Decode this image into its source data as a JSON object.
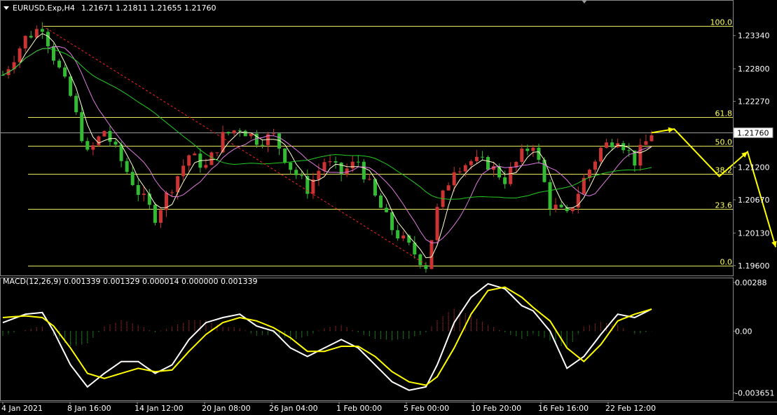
{
  "header": {
    "symbol": "EURUSD.Exp,H4",
    "ohlc": "1.21671 1.21811 1.21655 1.21760",
    "menu_icon": "triangle-down-icon"
  },
  "colors": {
    "bull": "#cc3333",
    "bear": "#33bb33",
    "fib": "#e6e65c",
    "ma_fast": "#ffffcc",
    "ma_mid": "#e07be0",
    "ma_slow": "#22cc22",
    "trend": "#ff2222",
    "arrow": "#ffff00",
    "macd_line": "#ffffff",
    "signal_line": "#ffff00",
    "axis": "#888888"
  },
  "chart_data": [
    {
      "type": "candlestick",
      "title": "EURUSD.Exp,H4",
      "ylim": [
        1.1945,
        1.2385
      ],
      "y_ticks": [
        "1.23340",
        "1.22800",
        "1.22270",
        "1.21760",
        "1.21200",
        "1.20670",
        "1.20130",
        "1.19600"
      ],
      "current_price": "1.21760",
      "fibonacci": {
        "high": 1.235,
        "low": 1.196,
        "levels": [
          {
            "label": "100.0",
            "ratio": 1.0
          },
          {
            "label": "61.8",
            "ratio": 0.618
          },
          {
            "label": "50.0",
            "ratio": 0.5
          },
          {
            "label": "38.2",
            "ratio": 0.382
          },
          {
            "label": "23.6",
            "ratio": 0.236
          },
          {
            "label": "0.0",
            "ratio": 0.0
          }
        ]
      },
      "trend_line": {
        "from": [
          "4 Jan 2021",
          1.235
        ],
        "to": [
          "5 Feb 00:00",
          1.1962
        ]
      },
      "price_path": [
        [
          0,
          1.227
        ],
        [
          4,
          1.233
        ],
        [
          7,
          1.235
        ],
        [
          9,
          1.23
        ],
        [
          12,
          1.2235
        ],
        [
          15,
          1.214
        ],
        [
          18,
          1.218
        ],
        [
          21,
          1.213
        ],
        [
          24,
          1.208
        ],
        [
          27,
          1.204
        ],
        [
          30,
          1.209
        ],
        [
          33,
          1.214
        ],
        [
          36,
          1.212
        ],
        [
          39,
          1.217
        ],
        [
          42,
          1.2185
        ],
        [
          45,
          1.2165
        ],
        [
          48,
          1.217
        ],
        [
          51,
          1.212
        ],
        [
          54,
          1.2085
        ],
        [
          57,
          1.213
        ],
        [
          60,
          1.211
        ],
        [
          63,
          1.213
        ],
        [
          66,
          1.207
        ],
        [
          69,
          1.202
        ],
        [
          72,
          1.199
        ],
        [
          75,
          1.196
        ],
        [
          77,
          1.205
        ],
        [
          80,
          1.212
        ],
        [
          83,
          1.213
        ],
        [
          86,
          1.2125
        ],
        [
          89,
          1.21
        ],
        [
          92,
          1.214
        ],
        [
          94,
          1.216
        ],
        [
          97,
          1.206
        ],
        [
          100,
          1.204
        ],
        [
          103,
          1.21
        ],
        [
          106,
          1.215
        ],
        [
          109,
          1.217
        ],
        [
          112,
          1.213
        ],
        [
          115,
          1.2176
        ]
      ],
      "forecast_path": [
        [
          115,
          1.2176
        ],
        [
          119,
          1.2182
        ],
        [
          127,
          1.2105
        ],
        [
          132,
          1.2145
        ],
        [
          137,
          1.199
        ]
      ]
    },
    {
      "type": "histogram_line",
      "title": "MACD(12,26,9) 0.001339 0.001329 0.000014 0.000000 0.001339",
      "ylim": [
        -0.00405,
        0.00308
      ],
      "y_ticks": [
        "0.00288",
        "0.00",
        "-0.003651"
      ],
      "x_ticks": [
        "4 Jan 2021",
        "8 Jan 16:00",
        "14 Jan 12:00",
        "20 Jan 08:00",
        "26 Jan 04:00",
        "1 Feb 00:00",
        "5 Feb 00:00",
        "10 Feb 20:00",
        "16 Feb 16:00",
        "22 Feb 12:00"
      ],
      "macd": [
        [
          0,
          0.0005
        ],
        [
          4,
          0.001
        ],
        [
          7,
          0.0011
        ],
        [
          9,
          0.0
        ],
        [
          12,
          -0.002
        ],
        [
          15,
          -0.0033
        ],
        [
          18,
          -0.0025
        ],
        [
          21,
          -0.0018
        ],
        [
          24,
          -0.0018
        ],
        [
          27,
          -0.0025
        ],
        [
          30,
          -0.002
        ],
        [
          33,
          -0.0005
        ],
        [
          36,
          0.0005
        ],
        [
          39,
          0.0008
        ],
        [
          42,
          0.001
        ],
        [
          45,
          0.0003
        ],
        [
          48,
          0.0
        ],
        [
          51,
          -0.001
        ],
        [
          54,
          -0.0015
        ],
        [
          57,
          -0.001
        ],
        [
          60,
          -0.0005
        ],
        [
          63,
          -0.001
        ],
        [
          66,
          -0.002
        ],
        [
          69,
          -0.003
        ],
        [
          72,
          -0.0035
        ],
        [
          75,
          -0.0033
        ],
        [
          77,
          -0.002
        ],
        [
          80,
          0.0005
        ],
        [
          83,
          0.002
        ],
        [
          86,
          0.0028
        ],
        [
          89,
          0.0025
        ],
        [
          92,
          0.0015
        ],
        [
          94,
          0.0012
        ],
        [
          97,
          0.0
        ],
        [
          100,
          -0.0022
        ],
        [
          103,
          -0.0015
        ],
        [
          106,
          -0.0002
        ],
        [
          109,
          0.001
        ],
        [
          112,
          0.0008
        ],
        [
          115,
          0.0013
        ]
      ],
      "signal": [
        [
          0,
          0.0008
        ],
        [
          4,
          0.0009
        ],
        [
          7,
          0.0008
        ],
        [
          9,
          0.0003
        ],
        [
          12,
          -0.001
        ],
        [
          15,
          -0.0025
        ],
        [
          18,
          -0.0028
        ],
        [
          21,
          -0.0025
        ],
        [
          24,
          -0.0022
        ],
        [
          27,
          -0.0024
        ],
        [
          30,
          -0.0023
        ],
        [
          33,
          -0.0012
        ],
        [
          36,
          -0.0002
        ],
        [
          39,
          0.0005
        ],
        [
          42,
          0.0008
        ],
        [
          45,
          0.0006
        ],
        [
          48,
          0.0002
        ],
        [
          51,
          -0.0004
        ],
        [
          54,
          -0.0012
        ],
        [
          57,
          -0.0012
        ],
        [
          60,
          -0.0009
        ],
        [
          63,
          -0.0009
        ],
        [
          66,
          -0.0015
        ],
        [
          69,
          -0.0024
        ],
        [
          72,
          -0.003
        ],
        [
          75,
          -0.0032
        ],
        [
          77,
          -0.0027
        ],
        [
          80,
          -0.001
        ],
        [
          83,
          0.001
        ],
        [
          86,
          0.0024
        ],
        [
          89,
          0.0026
        ],
        [
          92,
          0.002
        ],
        [
          94,
          0.0014
        ],
        [
          97,
          0.0006
        ],
        [
          100,
          -0.001
        ],
        [
          103,
          -0.0018
        ],
        [
          106,
          -0.0008
        ],
        [
          109,
          0.0006
        ],
        [
          112,
          0.001
        ],
        [
          115,
          0.0013
        ]
      ]
    }
  ]
}
